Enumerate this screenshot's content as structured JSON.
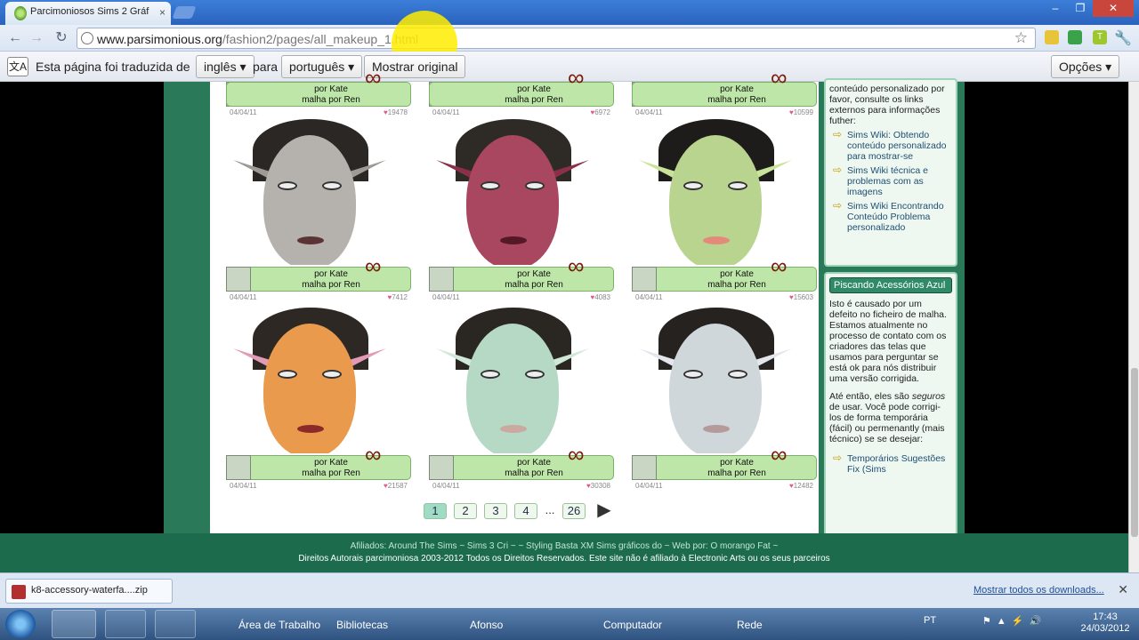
{
  "browser": {
    "tab_title": "Parcimoniosos Sims 2 Gráf",
    "url_host": "www.parsimonious.org",
    "url_path": "/fashion2/pages/all_makeup_1.html"
  },
  "translate_bar": {
    "prefix": "Esta página foi traduzida de",
    "from_lang": "inglês",
    "mid": "para",
    "to_lang": "português",
    "show_original": "Mostrar original",
    "options": "Opções"
  },
  "top_cards": [
    {
      "line1": "por Kate",
      "line2": "malha por Ren",
      "date": "04/04/11",
      "hearts": "19478"
    },
    {
      "line1": "por Kate",
      "line2": "malha por Ren",
      "date": "04/04/11",
      "hearts": "6972"
    },
    {
      "line1": "por Kate",
      "line2": "malha por Ren",
      "date": "04/04/11",
      "hearts": "10599"
    }
  ],
  "cards": [
    {
      "line1": "por Kate",
      "line2": "malha por Ren",
      "date": "04/04/11",
      "hearts": "7412",
      "skin": "#b5b1ad",
      "hair": "#2b2724",
      "lip": "#5a3434",
      "ear": "#9e9a96",
      "bg": "#ffffff"
    },
    {
      "line1": "por Kate",
      "line2": "malha por Ren",
      "date": "04/04/11",
      "hearts": "4083",
      "skin": "#a8475f",
      "hair": "#2e2a26",
      "lip": "#551826",
      "ear": "#8a3048",
      "bg": "#ffffff"
    },
    {
      "line1": "por Kate",
      "line2": "malha por Ren",
      "date": "04/04/11",
      "hearts": "15603",
      "skin": "#b9d48e",
      "hair": "#1e1c1a",
      "lip": "#e48a7a",
      "ear": "#c9e49a",
      "bg": "#ffffff"
    },
    {
      "line1": "por Kate",
      "line2": "malha por Ren",
      "date": "04/04/11",
      "hearts": "21587",
      "skin": "#e99a4c",
      "hair": "#2e2824",
      "lip": "#8c2a2a",
      "ear": "#e39ab7",
      "bg": "#ffffff"
    },
    {
      "line1": "por Kate",
      "line2": "malha por Ren",
      "date": "04/04/11",
      "hearts": "30308",
      "skin": "#b6d9c6",
      "hair": "#2a2622",
      "lip": "#c9a9a0",
      "ear": "#cfe8d8",
      "bg": "#ffffff"
    },
    {
      "line1": "por Kate",
      "line2": "malha por Ren",
      "date": "04/04/11",
      "hearts": "12482",
      "skin": "#d0d7da",
      "hair": "#25221f",
      "lip": "#b59a9a",
      "ear": "#e3e6ea",
      "bg": "#ffffff"
    }
  ],
  "pager": {
    "pages": [
      "1",
      "2",
      "3",
      "4"
    ],
    "dots": "...",
    "last": "26"
  },
  "sidebar": {
    "intro": "conteúdo personalizado por favor, consulte os links externos para informações futher:",
    "links": [
      "Sims Wiki: Obtendo conteúdo personalizado para mostrar-se",
      "Sims Wiki técnica e problemas com as imagens",
      "Sims Wiki Encontrando Conteúdo Problema personalizado"
    ],
    "box2_title": "Piscando Acessórios Azul",
    "box2_p1": "Isto é causado por um defeito no ficheiro de malha. Estamos atualmente no processo de contato com os criadores das telas que usamos para perguntar se está ok para nós distribuir uma versão corrigida.",
    "box2_p2a": "Até então, eles são",
    "box2_p2em": "seguros",
    "box2_p2b": "de usar. Você pode corrigi-los de forma temporária (fácil) ou permenantly (mais técnico) se se desejar:",
    "box2_link": "Temporários Sugestões Fix (Sims"
  },
  "footer": {
    "line1": "Afiliados: Around The Sims ~ Sims 3 Cri ~ ~ Styling Basta XM Sims gráficos do ~ Web por: O morango Fat ~",
    "line2": "Direitos Autorais parcimoniosa 2003-2012 Todos os Direitos Reservados. Este site não é afiliado à Electronic Arts ou os seus parceiros"
  },
  "downloads": {
    "file": "k8-accessory-waterfa....zip",
    "show_all": "Mostrar todos os downloads..."
  },
  "taskbar": {
    "items": [
      "Área de Trabalho",
      "Bibliotecas",
      "Afonso",
      "Computador",
      "Rede"
    ],
    "lang": "PT",
    "time": "17:43",
    "date": "24/03/2012"
  }
}
